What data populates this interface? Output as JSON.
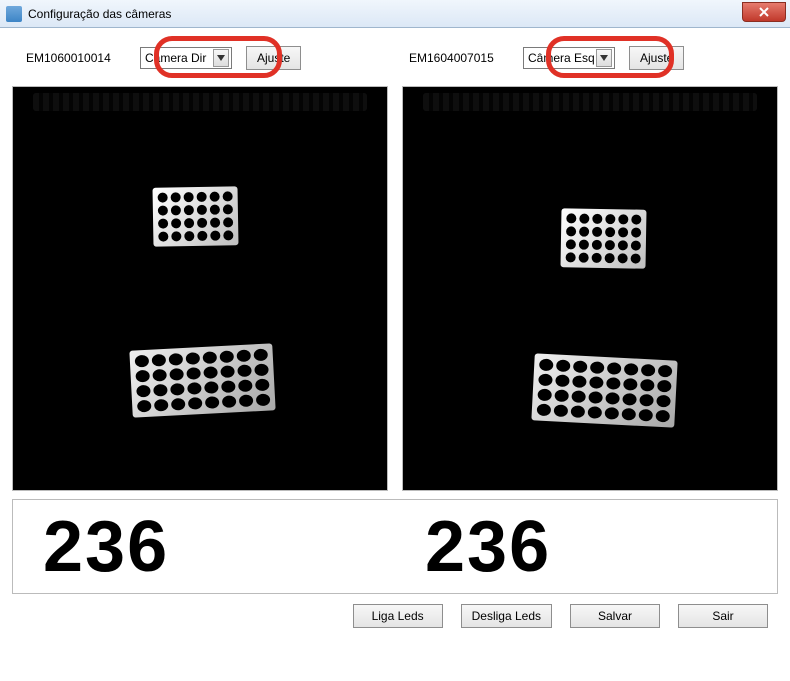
{
  "window": {
    "title": "Configuração das câmeras"
  },
  "left": {
    "id": "EM1060010014",
    "camera_selected": "Câmera Dir",
    "adjust_label": "Ajuste",
    "value": "236"
  },
  "right": {
    "id": "EM1604007015",
    "camera_selected": "Câmera Esq",
    "adjust_label": "Ajuste",
    "value": "236"
  },
  "buttons": {
    "liga": "Liga Leds",
    "desliga": "Desliga Leds",
    "salvar": "Salvar",
    "sair": "Sair"
  },
  "highlight_color": "#e03126"
}
